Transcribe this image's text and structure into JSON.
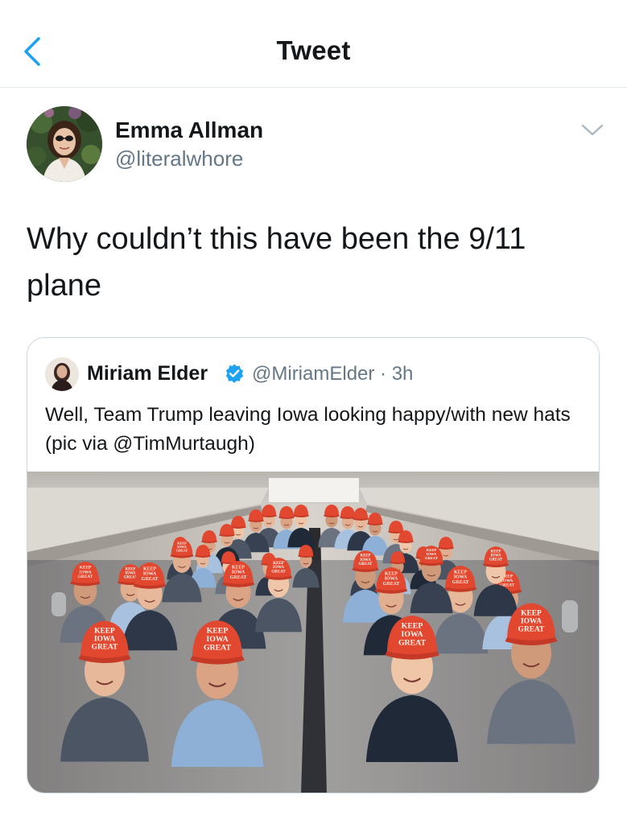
{
  "header": {
    "title": "Tweet",
    "back_icon": "chevron-left-icon"
  },
  "tweet": {
    "author_name": "Emma Allman",
    "author_handle": "@literalwhore",
    "text": "Why couldn’t this have been the 9/11 plane",
    "menu_icon": "chevron-down-icon"
  },
  "quote": {
    "author_name": "Miriam Elder",
    "verified": true,
    "handle_time": "@MiriamElder · 3h",
    "text": "Well, Team Trump leaving Iowa looking happy/with new hats (pic via @TimMurtaugh)",
    "hat_text": "KEEP IOWA GREAT",
    "hat_lines": [
      "KEEP",
      "IOWA",
      "GREAT"
    ]
  },
  "colors": {
    "accent": "#1da1f2",
    "text": "#14171a",
    "secondary": "#657786",
    "border": "#ccd6dd",
    "hat_red": "#e2472f"
  }
}
